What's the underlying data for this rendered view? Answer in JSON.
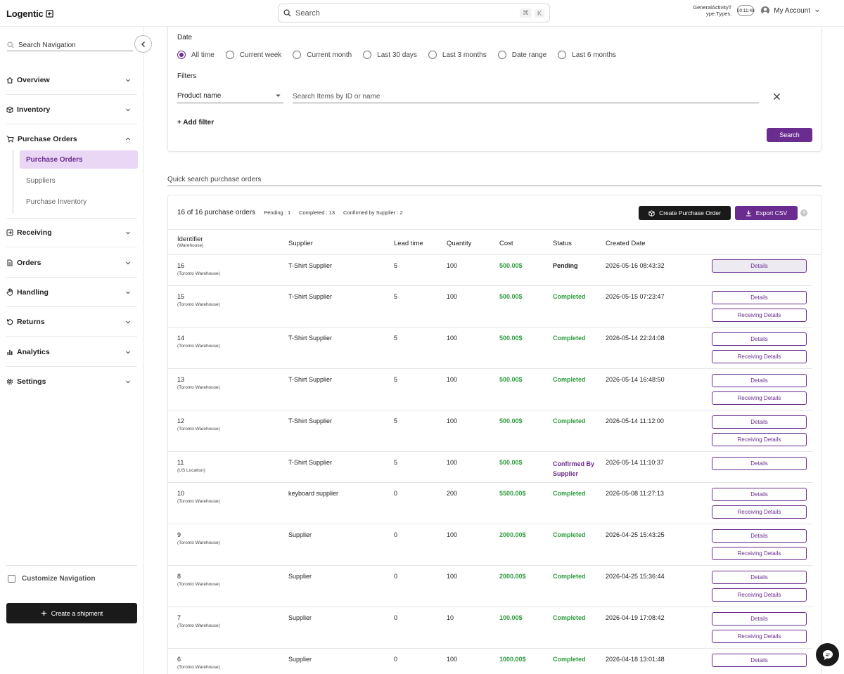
{
  "app": {
    "logo": "Logentic",
    "search_placeholder": "Search",
    "shortcut_keys": [
      "⌘",
      "K"
    ],
    "activity_label": "GeneralActivityT ype.Types.",
    "timer": "00:11:48",
    "account_label": "My Account"
  },
  "sidebar": {
    "search_placeholder": "Search Navigation",
    "items": [
      {
        "label": "Overview",
        "icon": "home-icon"
      },
      {
        "label": "Inventory",
        "icon": "box-icon"
      },
      {
        "label": "Purchase Orders",
        "icon": "cart-icon",
        "expanded": true
      },
      {
        "label": "Receiving",
        "icon": "receiving-icon"
      },
      {
        "label": "Orders",
        "icon": "document-icon"
      },
      {
        "label": "Handling",
        "icon": "hand-icon"
      },
      {
        "label": "Returns",
        "icon": "return-icon"
      },
      {
        "label": "Analytics",
        "icon": "chart-icon"
      },
      {
        "label": "Settings",
        "icon": "gear-icon"
      }
    ],
    "sub_items": [
      {
        "label": "Purchase Orders",
        "active": true
      },
      {
        "label": "Suppliers",
        "active": false
      },
      {
        "label": "Purchase Inventory",
        "active": false
      }
    ],
    "customize_label": "Customize Navigation",
    "create_shipment_label": "Create a shipment"
  },
  "filters": {
    "date_label": "Date",
    "date_options": [
      "All time",
      "Current week",
      "Current month",
      "Last 30 days",
      "Last 3 months",
      "Date range",
      "Last 6 months"
    ],
    "date_selected": "All time",
    "filters_label": "Filters",
    "filter_field": "Product name",
    "items_search_placeholder": "Search Items by ID or name",
    "add_filter_label": "+ Add filter",
    "search_button": "Search"
  },
  "quick_search_placeholder": "Quick search purchase orders",
  "summary": {
    "count_text": "16 of 16 purchase orders",
    "pending": "Pending : 1",
    "completed": "Completed : 13",
    "confirmed": "Confirmed by Supplier : 2"
  },
  "actions": {
    "create_po": "Create Purchase Order",
    "export_csv": "Export CSV",
    "help": "?"
  },
  "table": {
    "headers": {
      "identifier": "Identifier",
      "warehouse": "(Warehouse)",
      "supplier": "Supplier",
      "lead_time": "Lead time",
      "quantity": "Quantity",
      "cost": "Cost",
      "status": "Status",
      "created": "Created Date"
    },
    "details_label": "Details",
    "receiving_label": "Receiving Details",
    "rows": [
      {
        "id": "16",
        "warehouse": "(Toronto Warehouse)",
        "supplier": "T-Shirt Supplier",
        "lead": "5",
        "qty": "100",
        "cost": "500.00$",
        "status": "Pending",
        "status_type": "pending",
        "date": "2026-05-16 08:43:32",
        "receiving": false
      },
      {
        "id": "15",
        "warehouse": "(Toronto Warehouse)",
        "supplier": "T-Shirt Supplier",
        "lead": "5",
        "qty": "100",
        "cost": "500.00$",
        "status": "Completed",
        "status_type": "completed",
        "date": "2026-05-15 07:23:47",
        "receiving": true
      },
      {
        "id": "14",
        "warehouse": "(Toronto Warehouse)",
        "supplier": "T-Shirt Supplier",
        "lead": "5",
        "qty": "100",
        "cost": "500.00$",
        "status": "Completed",
        "status_type": "completed",
        "date": "2026-05-14 22:24:08",
        "receiving": true
      },
      {
        "id": "13",
        "warehouse": "(Toronto Warehouse)",
        "supplier": "T-Shirt Supplier",
        "lead": "5",
        "qty": "100",
        "cost": "500.00$",
        "status": "Completed",
        "status_type": "completed",
        "date": "2026-05-14 16:48:50",
        "receiving": true
      },
      {
        "id": "12",
        "warehouse": "(Toronto Warehouse)",
        "supplier": "T-Shirt Supplier",
        "lead": "5",
        "qty": "100",
        "cost": "500.00$",
        "status": "Completed",
        "status_type": "completed",
        "date": "2026-05-14 11:12:00",
        "receiving": true
      },
      {
        "id": "11",
        "warehouse": "(US Location)",
        "supplier": "T-Shirt Supplier",
        "lead": "5",
        "qty": "100",
        "cost": "500.00$",
        "status": "Confirmed By Supplier",
        "status_type": "confirmed",
        "date": "2026-05-14 11:10:37",
        "receiving": false
      },
      {
        "id": "10",
        "warehouse": "(Toronto Warehouse)",
        "supplier": "keyboard supplier",
        "lead": "0",
        "qty": "200",
        "cost": "5500.00$",
        "status": "Completed",
        "status_type": "completed",
        "date": "2026-05-08 11:27:13",
        "receiving": true
      },
      {
        "id": "9",
        "warehouse": "(Toronto Warehouse)",
        "supplier": "Supplier",
        "lead": "0",
        "qty": "100",
        "cost": "2000.00$",
        "status": "Completed",
        "status_type": "completed",
        "date": "2026-04-25 15:43:25",
        "receiving": true
      },
      {
        "id": "8",
        "warehouse": "(Toronto Warehouse)",
        "supplier": "Supplier",
        "lead": "0",
        "qty": "100",
        "cost": "2000.00$",
        "status": "Completed",
        "status_type": "completed",
        "date": "2026-04-25 15:36:44",
        "receiving": true
      },
      {
        "id": "7",
        "warehouse": "(Toronto Warehouse)",
        "supplier": "Supplier",
        "lead": "0",
        "qty": "10",
        "cost": "100.00$",
        "status": "Completed",
        "status_type": "completed",
        "date": "2026-04-19 17:08:42",
        "receiving": true
      },
      {
        "id": "6",
        "warehouse": "(Toronto Warehouse)",
        "supplier": "Supplier",
        "lead": "0",
        "qty": "100",
        "cost": "1000.00$",
        "status": "Completed",
        "status_type": "completed",
        "date": "2026-04-18 13:01:48",
        "receiving": false
      }
    ]
  },
  "colors": {
    "accent": "#6a2d8f",
    "active_bg": "#ead7f6",
    "success": "#2e9b3e",
    "dark": "#1a1a1a"
  }
}
